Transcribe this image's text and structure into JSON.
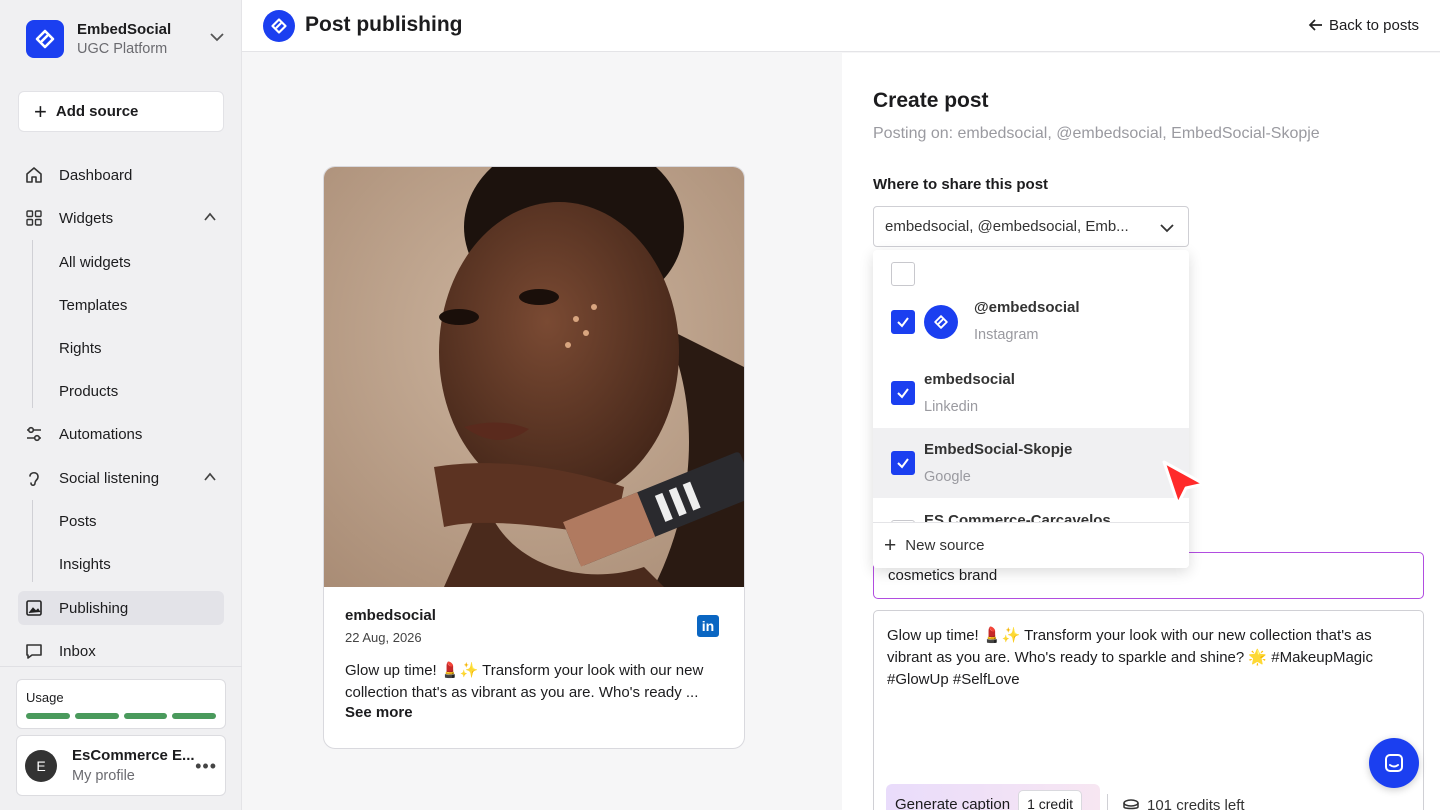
{
  "brand": {
    "name": "EmbedSocial",
    "subtitle": "UGC Platform"
  },
  "sidebar": {
    "add_source": "Add source",
    "items": [
      {
        "label": "Dashboard",
        "icon": "home-icon"
      },
      {
        "label": "Widgets",
        "icon": "grid-icon",
        "expanded": true
      },
      {
        "label": "All widgets"
      },
      {
        "label": "Templates"
      },
      {
        "label": "Rights"
      },
      {
        "label": "Products"
      },
      {
        "label": "Automations",
        "icon": "sliders-icon"
      },
      {
        "label": "Social listening",
        "icon": "ear-icon",
        "expanded": true
      },
      {
        "label": "Posts"
      },
      {
        "label": "Insights"
      },
      {
        "label": "Publishing",
        "icon": "image-icon",
        "active": true
      },
      {
        "label": "Inbox",
        "icon": "chat-icon"
      }
    ],
    "usage": {
      "label": "Usage",
      "segments": 4
    },
    "profile": {
      "initial": "E",
      "name": "EsCommerce E...",
      "subtitle": "My profile"
    }
  },
  "header": {
    "title": "Post publishing",
    "back_label": "Back to posts"
  },
  "preview": {
    "username": "embedsocial",
    "date": "22 Aug, 2026",
    "network_icon": "linkedin-icon",
    "text": "Glow up time! 💄✨ Transform your look with our new collection that's as vibrant as you are. Who's ready ...",
    "see_more": "See more"
  },
  "create_post": {
    "title": "Create post",
    "posting_on": "Posting on: embedsocial, @embedsocial, EmbedSocial-Skopje",
    "share_label": "Where to share this post",
    "select_value": "embedsocial, @embedsocial, Emb...",
    "options": [
      {
        "name": "",
        "type": "",
        "checked": false
      },
      {
        "name": "@embedsocial",
        "type": "Instagram",
        "checked": true
      },
      {
        "name": "embedsocial",
        "type": "Linkedin",
        "checked": true
      },
      {
        "name": "EmbedSocial-Skopje",
        "type": "Google",
        "checked": true
      },
      {
        "name": "ES Commerce-Carcavelos",
        "type": "",
        "checked": false
      }
    ],
    "new_source": "New source",
    "prompt_value": "cosmetics brand",
    "caption": "Glow up time! 💄✨ Transform your look with our new collection that's as vibrant as you are. Who's ready to sparkle and shine? 🌟 #MakeupMagic #GlowUp #SelfLove",
    "generate_label": "Generate caption",
    "credit_label": "1 credit",
    "credits_left": "101 credits left"
  },
  "colors": {
    "accent": "#1b3ff0",
    "prompt_border": "#b14de0",
    "usage_green": "#4a9a5c"
  }
}
